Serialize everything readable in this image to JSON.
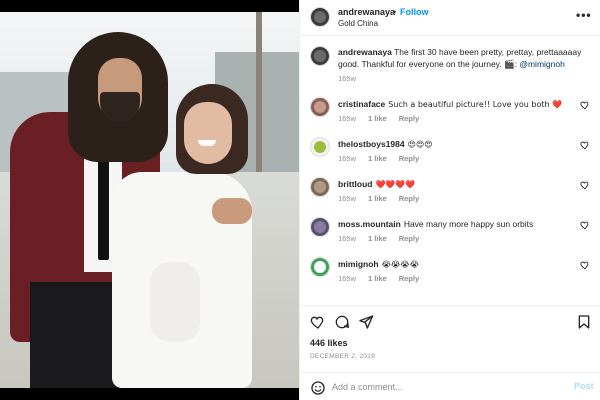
{
  "post": {
    "author": "andrewanaya",
    "separator": "•",
    "follow_label": "Follow",
    "location": "Gold China",
    "more_label": "•••"
  },
  "caption": {
    "author": "andrewanaya",
    "text": "The first 30 have been pretty, prettay, prettaaaaay good. Thankful for everyone on the journey. 🎬:",
    "mention": "@mimignoh",
    "time": "165w"
  },
  "comments": [
    {
      "user": "cristinaface",
      "text": "Such a beautiful picture!! Love you both ❤️",
      "time": "165w",
      "likes": "1 like",
      "reply": "Reply"
    },
    {
      "user": "thelostboys1984",
      "text": "😍😍😍",
      "time": "165w",
      "likes": "1 like",
      "reply": "Reply"
    },
    {
      "user": "brittloud",
      "text": "❤️❤️❤️❤️",
      "time": "165w",
      "likes": "1 like",
      "reply": "Reply"
    },
    {
      "user": "moss.mountain",
      "text": "Have many more happy sun orbits",
      "time": "165w",
      "likes": "1 like",
      "reply": "Reply"
    },
    {
      "user": "mimignoh",
      "text": "😭😭😭😭",
      "time": "165w",
      "likes": "1 like",
      "reply": "Reply"
    }
  ],
  "likes_count": "446 likes",
  "date": "DECEMBER 2, 2019",
  "add_comment": {
    "placeholder": "Add a comment...",
    "post_label": "Post"
  },
  "colors": {
    "accent": "#0095f6",
    "link": "#00376b",
    "muted": "#8e8e8e",
    "post_disabled": "#b3dbff"
  },
  "icons": [
    "heart-icon",
    "comment-icon",
    "share-icon",
    "bookmark-icon",
    "emoji-icon",
    "more-icon"
  ]
}
